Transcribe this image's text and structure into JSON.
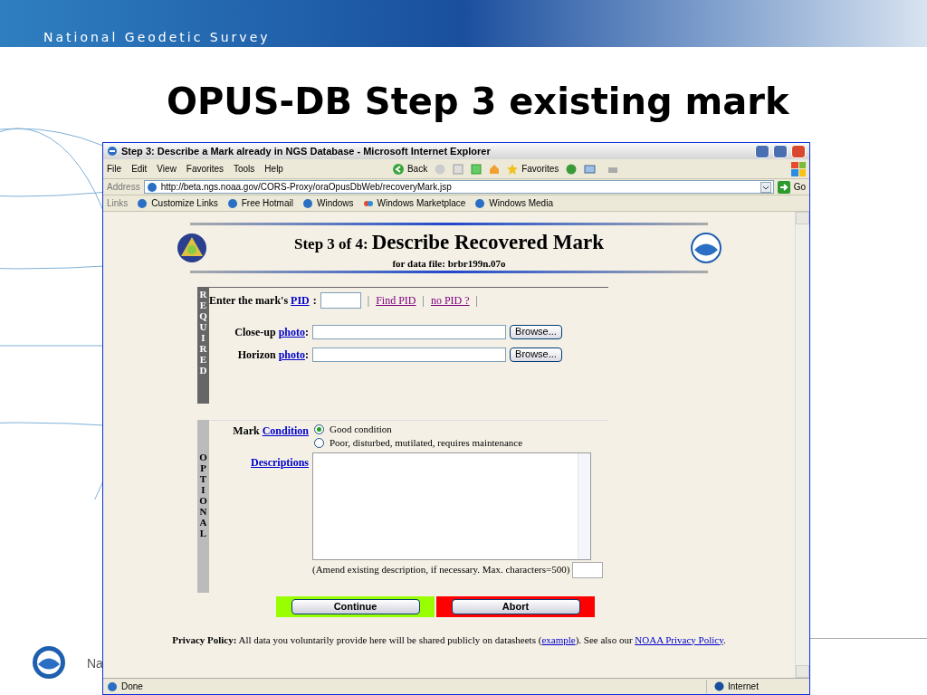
{
  "slide": {
    "header": "National Geodetic Survey",
    "title": "OPUS-DB Step 3 existing mark",
    "footer_text": "Na"
  },
  "browser": {
    "title": "Step 3: Describe a Mark already in NGS Database - Microsoft Internet Explorer",
    "menu": [
      "File",
      "Edit",
      "View",
      "Favorites",
      "Tools",
      "Help"
    ],
    "toolbar": [
      {
        "kind": "back",
        "label": "Back"
      },
      {
        "kind": "favorites",
        "label": "Favorites"
      }
    ],
    "address_label": "Address",
    "url": "http://beta.ngs.noaa.gov/CORS-Proxy/oraOpusDbWeb/recoveryMark.jsp",
    "go": "Go",
    "links_label": "Links",
    "links": [
      "Customize Links",
      "Free Hotmail",
      "Windows",
      "Windows Marketplace",
      "Windows Media"
    ],
    "status": "Done",
    "zone": "Internet"
  },
  "page": {
    "step": "Step 3 of 4:",
    "heading": "Describe Recovered Mark",
    "subheading": "for data file: brbr199n.07o",
    "required": {
      "label": "REQUIRED",
      "pid_prefix": "Enter the mark's",
      "pid_link": "PID",
      "colon": ":",
      "pid_items": [
        {
          "kind": "sep",
          "text": "|"
        },
        {
          "kind": "link",
          "text": "Find PID"
        },
        {
          "kind": "sep",
          "text": "|"
        },
        {
          "kind": "link",
          "text": "no PID ?"
        },
        {
          "kind": "sep",
          "text": "|"
        }
      ],
      "photos": [
        {
          "prefix": "Close-up",
          "link": "photo",
          "colon": ":",
          "browse": "Browse..."
        },
        {
          "prefix": "Horizon",
          "link": "photo",
          "colon": ":",
          "browse": "Browse..."
        }
      ]
    },
    "optional": {
      "label": "OPTIONAL",
      "condition_prefix": "Mark",
      "condition_link": "Condition",
      "options": [
        {
          "label": "Good condition",
          "selected": true
        },
        {
          "label": "Poor, disturbed, mutilated, requires maintenance",
          "selected": false
        }
      ],
      "descriptions_link": "Descriptions",
      "note": "(Amend existing description, if necessary. Max. characters=500)"
    },
    "buttons": [
      {
        "label": "Continue",
        "color": "#99ff00"
      },
      {
        "label": "Abort",
        "color": "#ff0000"
      }
    ],
    "privacy": {
      "text": "**Privacy Policy:** All data you voluntarily provide here will be shared publicly on datasheets (",
      "link": "example",
      "middle": "). See also our ",
      "link2": "NOAA Privacy Policy",
      "end": "."
    }
  }
}
